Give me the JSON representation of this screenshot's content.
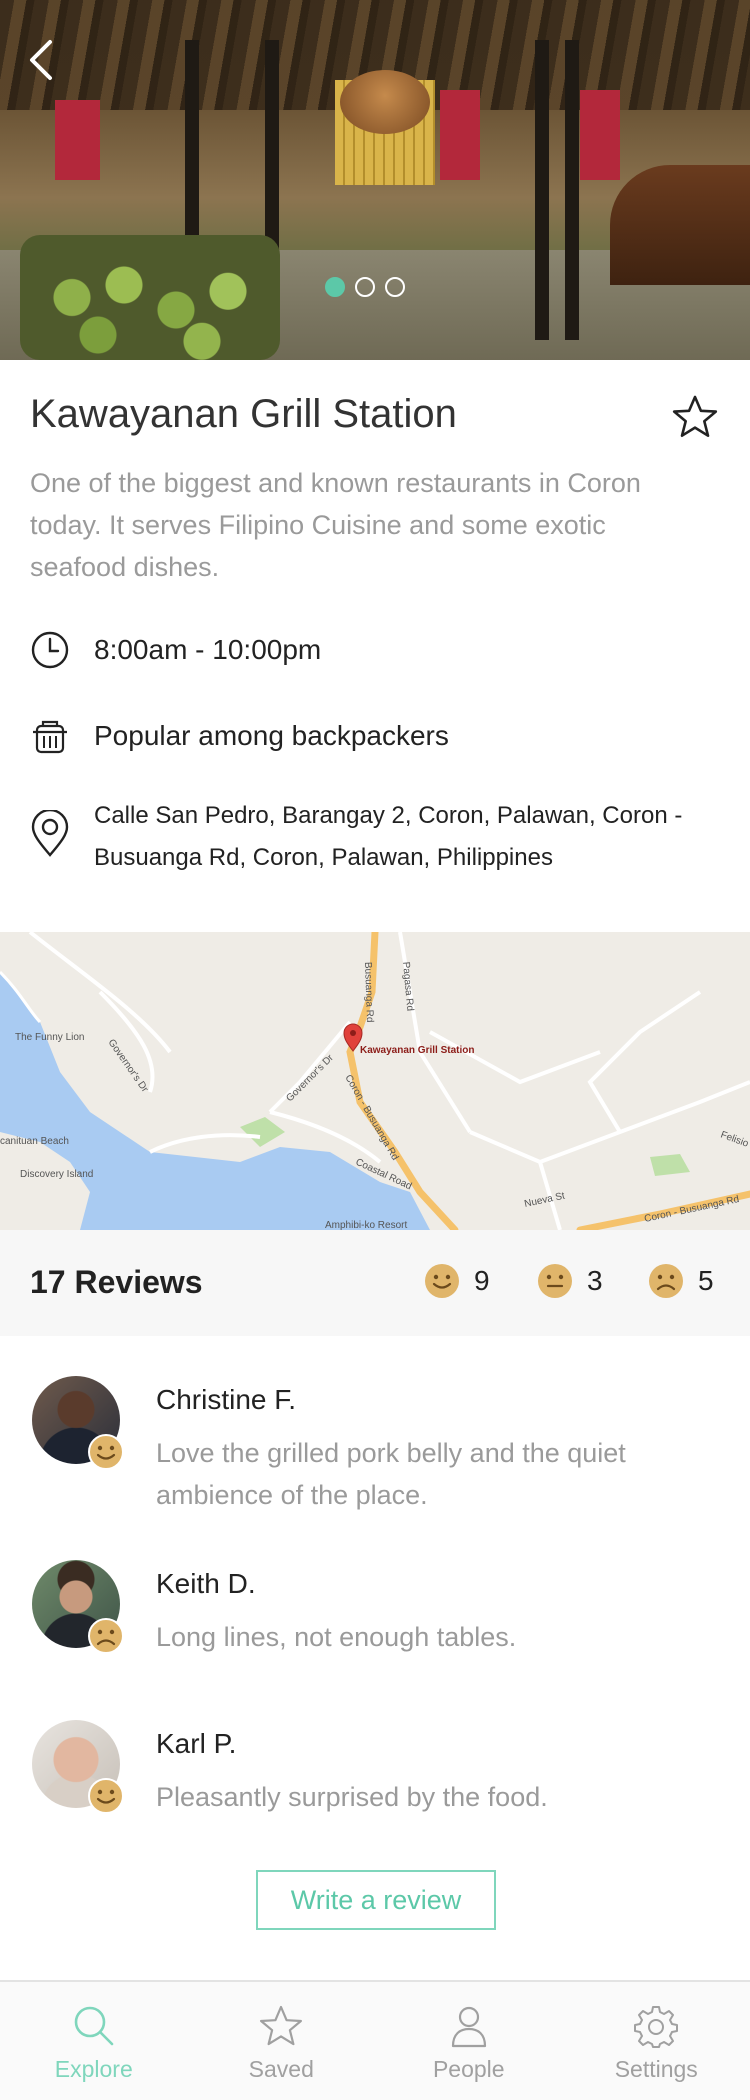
{
  "place": {
    "name": "Kawayanan Grill Station",
    "description": "One of the biggest and known restaurants in Coron today. It serves Filipino Cuisine and some exotic seafood dishes.",
    "hours": "8:00am - 10:00pm",
    "popularity": "Popular among backpackers",
    "address": "Calle San Pedro, Barangay 2, Coron, Palawan, Coron - Busuanga Rd, Coron, Palawan, Philippines"
  },
  "carousel": {
    "total": 3,
    "active_index": 0
  },
  "map": {
    "marker_label": "Kawayanan Grill Station",
    "streets": [
      "Busuanga Rd",
      "Pagasa Rd",
      "Governor's Dr",
      "Governor's Dr",
      "Coron - Busuanga Rd",
      "Coastal Road",
      "Nueva St",
      "Coron - Busuanga Rd",
      "Felisio",
      "Amphibi-ko Resort"
    ],
    "places": [
      "The Funny Lion",
      "Discovery Island",
      "canituan Beach"
    ]
  },
  "reviews_summary": {
    "count_label": "17 Reviews",
    "happy": "9",
    "neutral": "3",
    "sad": "5"
  },
  "reviews": [
    {
      "name": "Christine F.",
      "text": "Love the grilled pork belly and the quiet ambience of the place.",
      "mood": "happy"
    },
    {
      "name": "Keith D.",
      "text": "Long lines, not enough tables.",
      "mood": "sad"
    },
    {
      "name": "Karl P.",
      "text": "Pleasantly surprised by the food.",
      "mood": "happy"
    }
  ],
  "write_review_label": "Write a review",
  "tabs": [
    {
      "label": "Explore",
      "icon": "search-icon",
      "active": true
    },
    {
      "label": "Saved",
      "icon": "star-icon",
      "active": false
    },
    {
      "label": "People",
      "icon": "person-icon",
      "active": false
    },
    {
      "label": "Settings",
      "icon": "gear-icon",
      "active": false
    }
  ],
  "colors": {
    "accent": "#5cc8a8",
    "face": "#e0b56a",
    "face_feature": "#6b4a1c",
    "muted_text": "#9a9a9a"
  }
}
